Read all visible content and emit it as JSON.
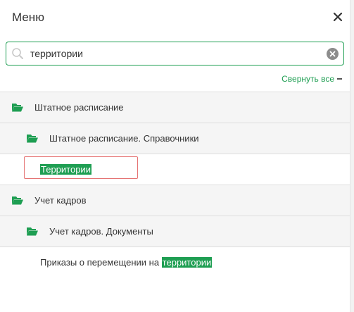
{
  "header": {
    "title": "Меню"
  },
  "search": {
    "value": "территории"
  },
  "controls": {
    "collapse_all": "Свернуть все"
  },
  "tree": {
    "group1": {
      "label": "Штатное расписание"
    },
    "group1_sub": {
      "label": "Штатное расписание. Справочники"
    },
    "leaf1": {
      "highlight": "Территории"
    },
    "group2": {
      "label": "Учет кадров"
    },
    "group2_sub": {
      "label": "Учет кадров. Документы"
    },
    "leaf2": {
      "prefix": "Приказы о перемещении на ",
      "highlight": "территории"
    }
  },
  "colors": {
    "accent": "#1e9e52",
    "selection_border": "#e57373"
  }
}
